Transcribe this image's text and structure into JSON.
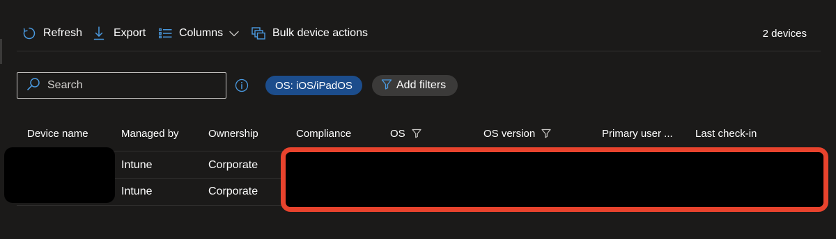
{
  "toolbar": {
    "refresh_label": "Refresh",
    "export_label": "Export",
    "columns_label": "Columns",
    "bulk_label": "Bulk device actions",
    "device_count": "2 devices"
  },
  "search": {
    "placeholder": "Search",
    "value": ""
  },
  "filters": {
    "active_chip": "OS: iOS/iPadOS",
    "add_label": "Add filters"
  },
  "table": {
    "columns": [
      "Device name",
      "Managed by",
      "Ownership",
      "Compliance",
      "OS",
      "OS version",
      "Primary user ...",
      "Last check-in"
    ],
    "rows": [
      {
        "managed_by": "Intune",
        "ownership": "Corporate"
      },
      {
        "managed_by": "Intune",
        "ownership": "Corporate"
      }
    ]
  },
  "colors": {
    "background": "#1b1a19",
    "accent": "#4a9ae1",
    "chip_active": "#1c4d8c",
    "chip_neutral": "#3b3a39",
    "redaction_border": "#e8432d"
  },
  "icons": [
    "refresh-icon",
    "download-icon",
    "columns-list-icon",
    "chevron-down-icon",
    "bulk-actions-icon",
    "search-icon",
    "info-icon",
    "filter-icon"
  ]
}
